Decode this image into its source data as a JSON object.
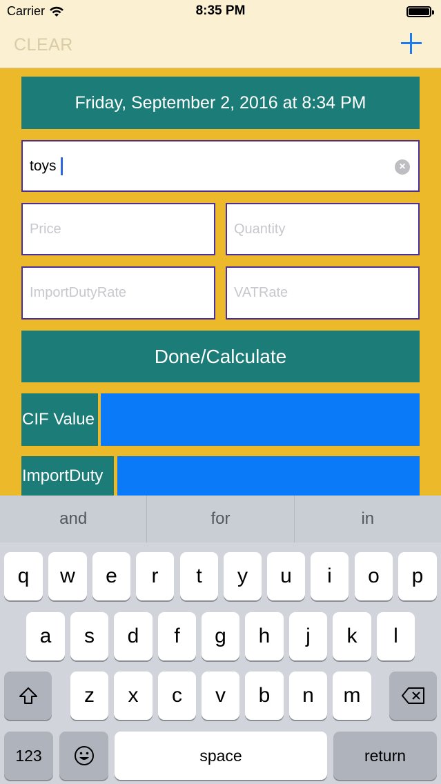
{
  "status_bar": {
    "carrier": "Carrier",
    "time": "8:35 PM"
  },
  "nav": {
    "clear_label": "CLEAR",
    "add_icon": "plus-icon"
  },
  "form": {
    "date_text": "Friday, September 2, 2016 at 8:34 PM",
    "item_value": "toys",
    "price_placeholder": "Price",
    "quantity_placeholder": "Quantity",
    "import_duty_rate_placeholder": "ImportDutyRate",
    "vat_rate_placeholder": "VATRate",
    "calculate_label": "Done/Calculate"
  },
  "results": {
    "cif_label": "CIF Value",
    "import_duty_label": "ImportDuty"
  },
  "keyboard": {
    "suggestions": [
      "and",
      "for",
      "in"
    ],
    "row1": [
      "q",
      "w",
      "e",
      "r",
      "t",
      "y",
      "u",
      "i",
      "o",
      "p"
    ],
    "row2": [
      "a",
      "s",
      "d",
      "f",
      "g",
      "h",
      "j",
      "k",
      "l"
    ],
    "row3": [
      "z",
      "x",
      "c",
      "v",
      "b",
      "n",
      "m"
    ],
    "numbers_key": "123",
    "space_key": "space",
    "return_key": "return"
  },
  "colors": {
    "background": "#EBB929",
    "teal": "#1C7C78",
    "blue": "#0B7AF9",
    "nav_tint": "#1A7CF2"
  }
}
